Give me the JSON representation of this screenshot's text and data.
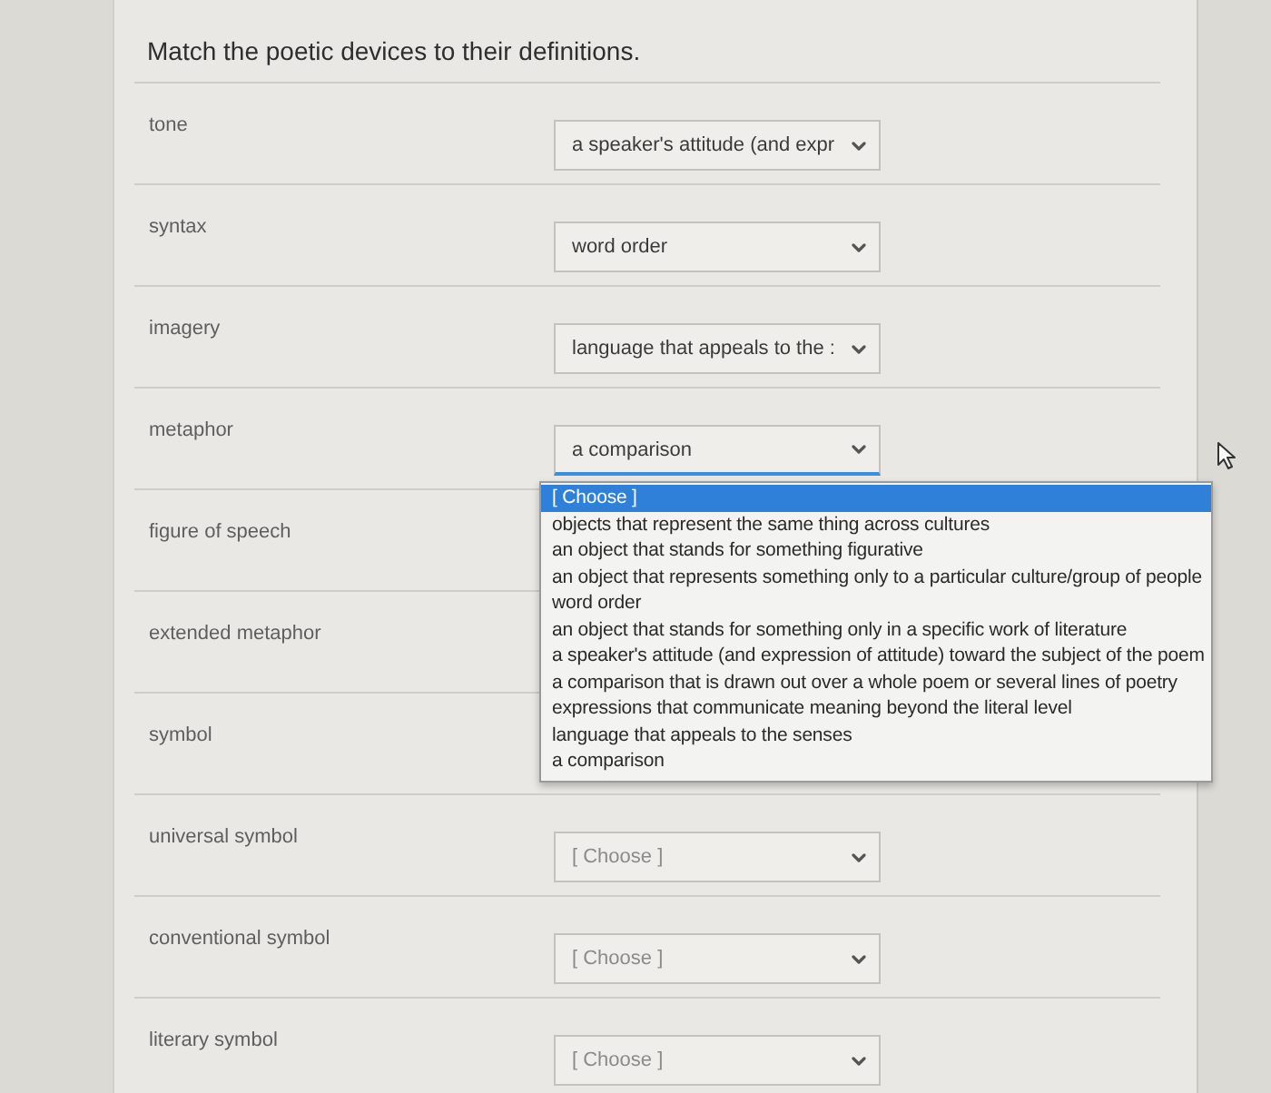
{
  "question": {
    "prompt": "Match the poetic devices to their definitions."
  },
  "rows": [
    {
      "term": "tone",
      "answer": "a speaker's attitude (and expr",
      "expanded": false
    },
    {
      "term": "syntax",
      "answer": "word order",
      "expanded": false
    },
    {
      "term": "imagery",
      "answer": "language that appeals to the :",
      "expanded": false
    },
    {
      "term": "metaphor",
      "answer": "a comparison",
      "expanded": true,
      "options": [
        {
          "label": "[ Choose ]",
          "selected": true
        },
        {
          "label": "objects that represent the same thing across cultures",
          "selected": false
        },
        {
          "label": "an object that stands for something figurative",
          "selected": false
        },
        {
          "label": "an object that represents something only to a particular culture/group of people",
          "selected": false
        },
        {
          "label": "word order",
          "selected": false
        },
        {
          "label": "an object that stands for something only in a specific work of literature",
          "selected": false
        },
        {
          "label": "a speaker's attitude (and expression of attitude) toward the subject of the poem",
          "selected": false
        },
        {
          "label": "a comparison that is drawn out over a whole poem or several lines of poetry",
          "selected": false
        },
        {
          "label": "expressions that communicate meaning beyond the literal level",
          "selected": false
        },
        {
          "label": "language that appeals to the senses",
          "selected": false
        },
        {
          "label": "a comparison",
          "selected": false
        }
      ]
    },
    {
      "term": "figure of speech"
    },
    {
      "term": "extended metaphor"
    },
    {
      "term": "symbol"
    },
    {
      "term": "universal symbol",
      "placeholder": "[ Choose ]",
      "expanded": false
    },
    {
      "term": "conventional symbol",
      "placeholder": "[ Choose ]",
      "expanded": false
    },
    {
      "term": "literary symbol",
      "placeholder": "[ Choose ]",
      "expanded": false
    }
  ]
}
